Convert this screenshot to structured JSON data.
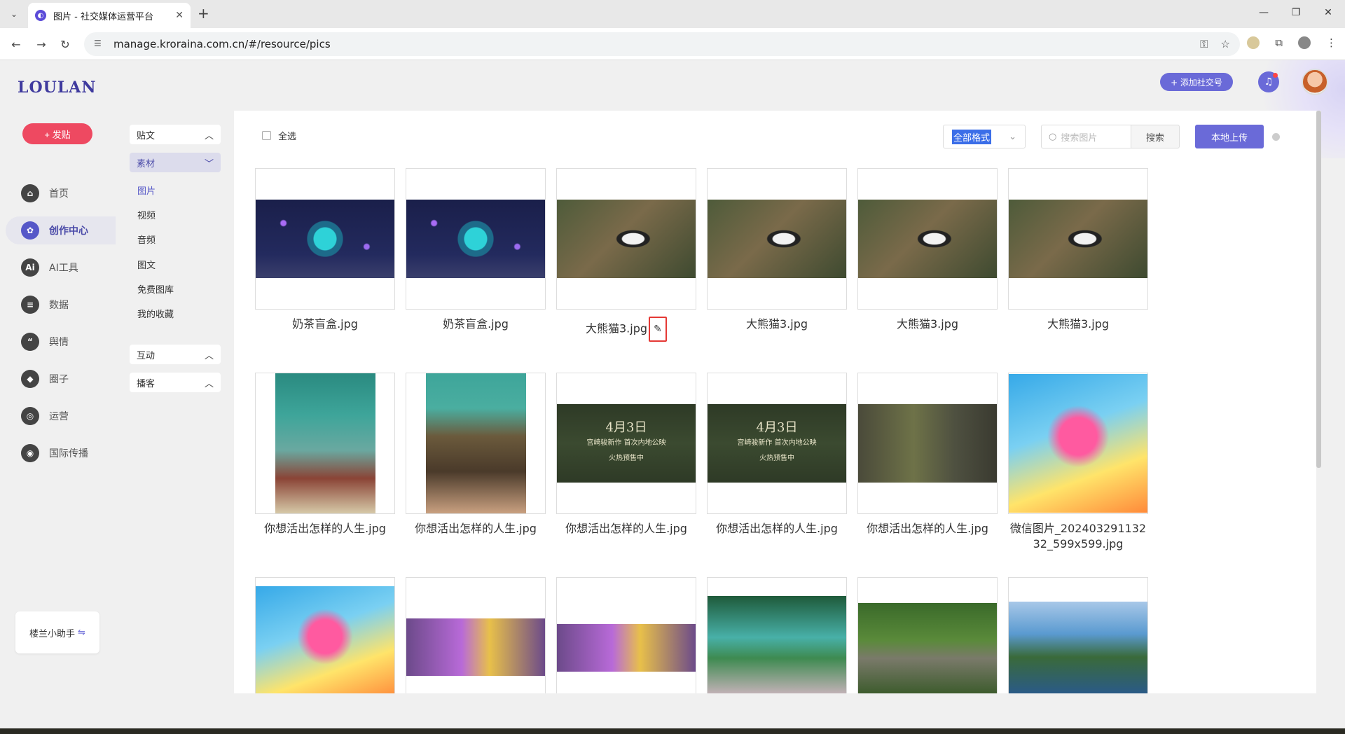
{
  "browser": {
    "tab_title": "图片 - 社交媒体运营平台",
    "url": "manage.kroraina.com.cn/#/resource/pics"
  },
  "app": {
    "logo": "LOULAN",
    "publish_label": "+ 发贴",
    "nav": [
      {
        "label": "首页",
        "icon": "home-icon"
      },
      {
        "label": "创作中心",
        "icon": "palette-icon"
      },
      {
        "label": "AI工具",
        "icon": "ai-icon"
      },
      {
        "label": "数据",
        "icon": "database-icon"
      },
      {
        "label": "舆情",
        "icon": "quote-icon"
      },
      {
        "label": "圈子",
        "icon": "compass-icon"
      },
      {
        "label": "运营",
        "icon": "operation-icon"
      },
      {
        "label": "国际传播",
        "icon": "globe-icon"
      }
    ],
    "assistant_label": "楼兰小助手",
    "add_social_label": "+ 添加社交号",
    "accent_color": "#6a6ad8",
    "publish_color": "#ee4961"
  },
  "submenu": {
    "groups": [
      {
        "label": "贴文"
      },
      {
        "label": "素材"
      },
      {
        "label": "互动"
      },
      {
        "label": "播客"
      }
    ],
    "items": [
      "图片",
      "视频",
      "音频",
      "图文",
      "免费图库",
      "我的收藏"
    ]
  },
  "toolbar": {
    "select_all": "全选",
    "format_filter": "全部格式",
    "search_placeholder": "搜索图片",
    "search_button": "搜索",
    "upload_button": "本地上传"
  },
  "images": [
    {
      "name": "奶茶盲盒.jpg"
    },
    {
      "name": "奶茶盲盒.jpg"
    },
    {
      "name": "大熊猫3.jpg"
    },
    {
      "name": "大熊猫3.jpg"
    },
    {
      "name": "大熊猫3.jpg"
    },
    {
      "name": "大熊猫3.jpg"
    },
    {
      "name": "你想活出怎样的人生.jpg"
    },
    {
      "name": "你想活出怎样的人生.jpg"
    },
    {
      "name": "你想活出怎样的人生.jpg",
      "overlay_line1": "4月3日",
      "overlay_line2": "宫崎骏新作 首次内地公映",
      "overlay_line3": "火热预售中"
    },
    {
      "name": "你想活出怎样的人生.jpg",
      "overlay_line1": "4月3日",
      "overlay_line2": "宫崎骏新作 首次内地公映",
      "overlay_line3": "火热预售中"
    },
    {
      "name": "你想活出怎样的人生.jpg"
    },
    {
      "name": "微信图片_20240329113232_599x599.jpg"
    },
    {
      "name": ""
    },
    {
      "name": ""
    },
    {
      "name": ""
    },
    {
      "name": ""
    },
    {
      "name": ""
    },
    {
      "name": ""
    }
  ]
}
